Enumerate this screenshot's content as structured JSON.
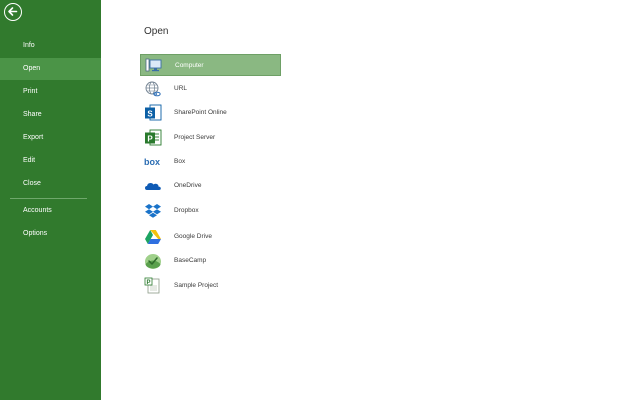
{
  "sidebar": {
    "back_icon": "back-arrow-icon",
    "items": [
      {
        "label": "Info"
      },
      {
        "label": "Open",
        "active": true
      },
      {
        "label": "Print"
      },
      {
        "label": "Share"
      },
      {
        "label": "Export"
      },
      {
        "label": "Edit"
      },
      {
        "label": "Close"
      }
    ],
    "bottom_items": [
      {
        "label": "Accounts"
      },
      {
        "label": "Options"
      }
    ]
  },
  "main": {
    "title": "Open",
    "locations": [
      {
        "label": "Computer",
        "icon": "computer-icon",
        "selected": true
      },
      {
        "label": "URL",
        "icon": "url-globe-icon"
      },
      {
        "label": "SharePoint Online",
        "icon": "sharepoint-icon"
      },
      {
        "label": "Project Server",
        "icon": "project-server-icon"
      },
      {
        "label": "Box",
        "icon": "box-icon"
      },
      {
        "label": "OneDrive",
        "icon": "onedrive-icon"
      },
      {
        "label": "Dropbox",
        "icon": "dropbox-icon"
      },
      {
        "label": "Google Drive",
        "icon": "google-drive-icon"
      },
      {
        "label": "BaseCamp",
        "icon": "basecamp-icon"
      },
      {
        "label": "Sample Project",
        "icon": "sample-project-icon"
      }
    ]
  },
  "colors": {
    "sidebar_bg": "#317a2d",
    "sidebar_active": "#4b9447",
    "selected_bg": "#8ab882"
  }
}
